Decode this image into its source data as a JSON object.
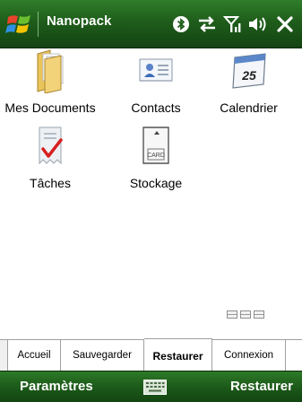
{
  "window": {
    "title": "Nanopack"
  },
  "status_icons": [
    "bluetooth-icon",
    "connectivity-icon",
    "signal-icon",
    "volume-icon",
    "close-icon"
  ],
  "apps": [
    {
      "label": "Mes Documents",
      "icon": "folder-icon"
    },
    {
      "label": "Contacts",
      "icon": "contacts-icon"
    },
    {
      "label": "Calendrier",
      "icon": "calendar-icon",
      "day": "25"
    },
    {
      "label": "Tâches",
      "icon": "tasks-icon"
    },
    {
      "label": "Stockage",
      "icon": "storage-card-icon",
      "card_text": "CARD"
    }
  ],
  "tabs": [
    {
      "label": "Accueil",
      "selected": false
    },
    {
      "label": "Sauvegarder",
      "selected": false
    },
    {
      "label": "Restaurer",
      "selected": true
    },
    {
      "label": "Connexion",
      "selected": false
    }
  ],
  "softkeys": {
    "left": "Paramètres",
    "right": "Restaurer"
  },
  "colors": {
    "bar_green": "#1f5d1b",
    "tab_bg": "#ffffff",
    "text": "#000000"
  }
}
